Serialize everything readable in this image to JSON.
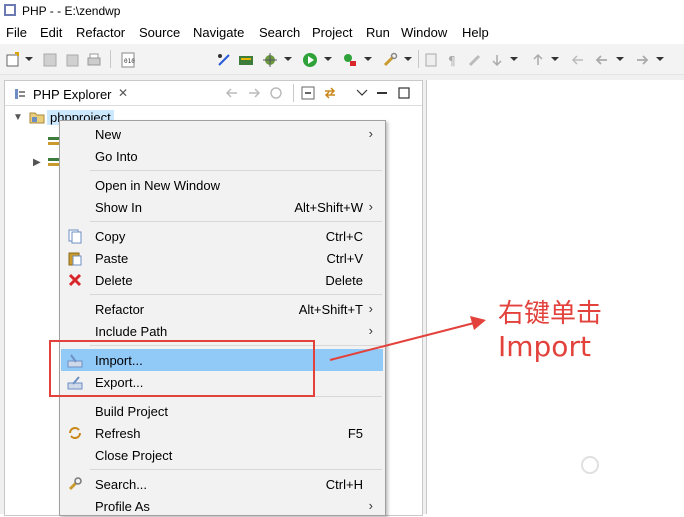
{
  "window": {
    "title": "PHP -  - E:\\zendwp"
  },
  "menubar": [
    "File",
    "Edit",
    "Refactor",
    "Source",
    "Navigate",
    "Search",
    "Project",
    "Run",
    "Window",
    "Help"
  ],
  "explorer": {
    "tab_label": "PHP Explorer",
    "tab_close": "✕",
    "project_name": "phpproject"
  },
  "context_menu": {
    "items": [
      {
        "label": "New",
        "accel": "",
        "submenu": true
      },
      {
        "label": "Go Into",
        "accel": "",
        "submenu": false
      },
      {
        "label": "Open in New Window",
        "accel": "",
        "submenu": false
      },
      {
        "label": "Show In",
        "accel": "Alt+Shift+W",
        "submenu": true
      },
      {
        "label": "Copy",
        "accel": "Ctrl+C",
        "submenu": false
      },
      {
        "label": "Paste",
        "accel": "Ctrl+V",
        "submenu": false
      },
      {
        "label": "Delete",
        "accel": "Delete",
        "submenu": false
      },
      {
        "label": "Refactor",
        "accel": "Alt+Shift+T",
        "submenu": true
      },
      {
        "label": "Include Path",
        "accel": "",
        "submenu": true
      },
      {
        "label": "Import...",
        "accel": "",
        "submenu": false
      },
      {
        "label": "Export...",
        "accel": "",
        "submenu": false
      },
      {
        "label": "Build Project",
        "accel": "",
        "submenu": false
      },
      {
        "label": "Refresh",
        "accel": "F5",
        "submenu": false
      },
      {
        "label": "Close Project",
        "accel": "",
        "submenu": false
      },
      {
        "label": "Search...",
        "accel": "Ctrl+H",
        "submenu": false
      },
      {
        "label": "Profile As",
        "accel": "",
        "submenu": true
      }
    ],
    "submenu_arrow": "›"
  },
  "annotation": {
    "line1": "右键单击",
    "line2": "Import"
  },
  "colors": {
    "highlight": "#91c9f7",
    "annotation": "#e3413b",
    "selection": "#cce8ff"
  }
}
